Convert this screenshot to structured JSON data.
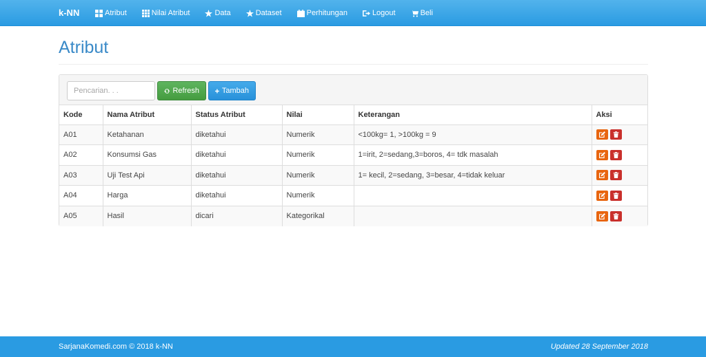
{
  "navbar": {
    "brand": "k-NN",
    "items": [
      {
        "label": "Atribut",
        "icon": "th-large-icon"
      },
      {
        "label": "Nilai Atribut",
        "icon": "th-icon"
      },
      {
        "label": "Data",
        "icon": "star-icon"
      },
      {
        "label": "Dataset",
        "icon": "star-icon"
      },
      {
        "label": "Perhitungan",
        "icon": "calendar-icon"
      },
      {
        "label": "Logout",
        "icon": "logout-icon"
      },
      {
        "label": "Beli",
        "icon": "cart-icon"
      }
    ]
  },
  "page": {
    "title": "Atribut"
  },
  "toolbar": {
    "search_placeholder": "Pencarian. . .",
    "refresh_label": "Refresh",
    "add_label": "Tambah"
  },
  "table": {
    "headers": [
      "Kode",
      "Nama Atribut",
      "Status Atribut",
      "Nilai",
      "Keterangan",
      "Aksi"
    ],
    "rows": [
      [
        "A01",
        "Ketahanan",
        "diketahui",
        "Numerik",
        "<100kg= 1, >100kg = 9"
      ],
      [
        "A02",
        "Konsumsi Gas",
        "diketahui",
        "Numerik",
        "1=irit, 2=sedang,3=boros, 4= tdk masalah"
      ],
      [
        "A03",
        "Uji Test Api",
        "diketahui",
        "Numerik",
        "1= kecil, 2=sedang, 3=besar, 4=tidak keluar"
      ],
      [
        "A04",
        "Harga",
        "diketahui",
        "Numerik",
        ""
      ],
      [
        "A05",
        "Hasil",
        "dicari",
        "Kategorikal",
        ""
      ]
    ]
  },
  "footer": {
    "left": "SarjanaKomedi.com © 2018 k-NN",
    "right": "Updated 28 September 2018"
  },
  "colors": {
    "navbar": "#2a9be2",
    "title": "#3a8ac8",
    "refresh_button": "#4cae4c",
    "add_button": "#2891da",
    "edit_action": "#e8650f",
    "delete_action": "#c9302c"
  }
}
